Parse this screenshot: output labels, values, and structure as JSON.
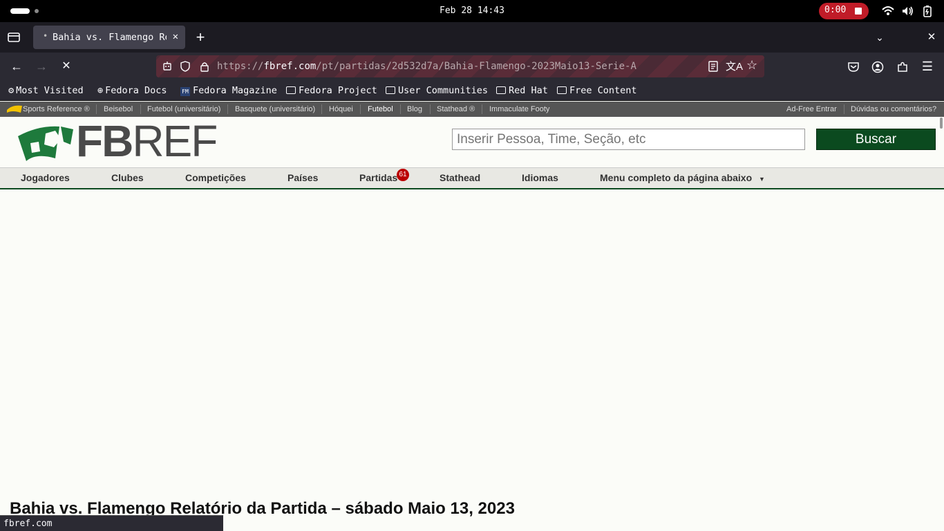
{
  "system": {
    "clock": "Feb 28  14:43",
    "recording_time": "0:00"
  },
  "browser": {
    "tab_title": "Bahia vs. Flamengo Relatório da Partida",
    "url_prefix": "https://",
    "url_domain": "fbref.com",
    "url_path": "/pt/partidas/2d532d7a/Bahia-Flamengo-2023Maio13-Serie-A",
    "status_text": "fbref.com"
  },
  "bookmarks": [
    {
      "label": "Most Visited",
      "icon": "gear-icon"
    },
    {
      "label": "Fedora Docs",
      "icon": "globe-icon"
    },
    {
      "label": "Fedora Magazine",
      "icon": "fm-icon"
    },
    {
      "label": "Fedora Project",
      "icon": "folder-icon"
    },
    {
      "label": "User Communities",
      "icon": "folder-icon"
    },
    {
      "label": "Red Hat",
      "icon": "folder-icon"
    },
    {
      "label": "Free Content",
      "icon": "folder-icon"
    }
  ],
  "sr_bar": {
    "items": [
      "Sports Reference ®",
      "Beisebol",
      "Futebol (universitário)",
      "Basquete (universitário)",
      "Hóquei",
      "Futebol",
      "Blog",
      "Stathead ®",
      "Immaculate Footy"
    ],
    "right": [
      "Ad-Free Entrar",
      "Dúvidas ou comentários?"
    ]
  },
  "site": {
    "logo_bold": "FB",
    "logo_light": "REF",
    "search_placeholder": "Inserir Pessoa, Time, Seção, etc",
    "search_button": "Buscar",
    "nav": [
      "Jogadores",
      "Clubes",
      "Competições",
      "Países",
      "Partidas",
      "Stathead",
      "Idiomas",
      "Menu completo da página abaixo"
    ],
    "nav_badge": "61",
    "dropdown_arrow": "▼"
  },
  "page": {
    "title": "Bahia vs. Flamengo Relatório da Partida – sábado Maio 13, 2023"
  },
  "colors": {
    "brand_green": "#0b4a1f",
    "logo_green": "#1e7a3c",
    "record_red": "#c01c28"
  }
}
